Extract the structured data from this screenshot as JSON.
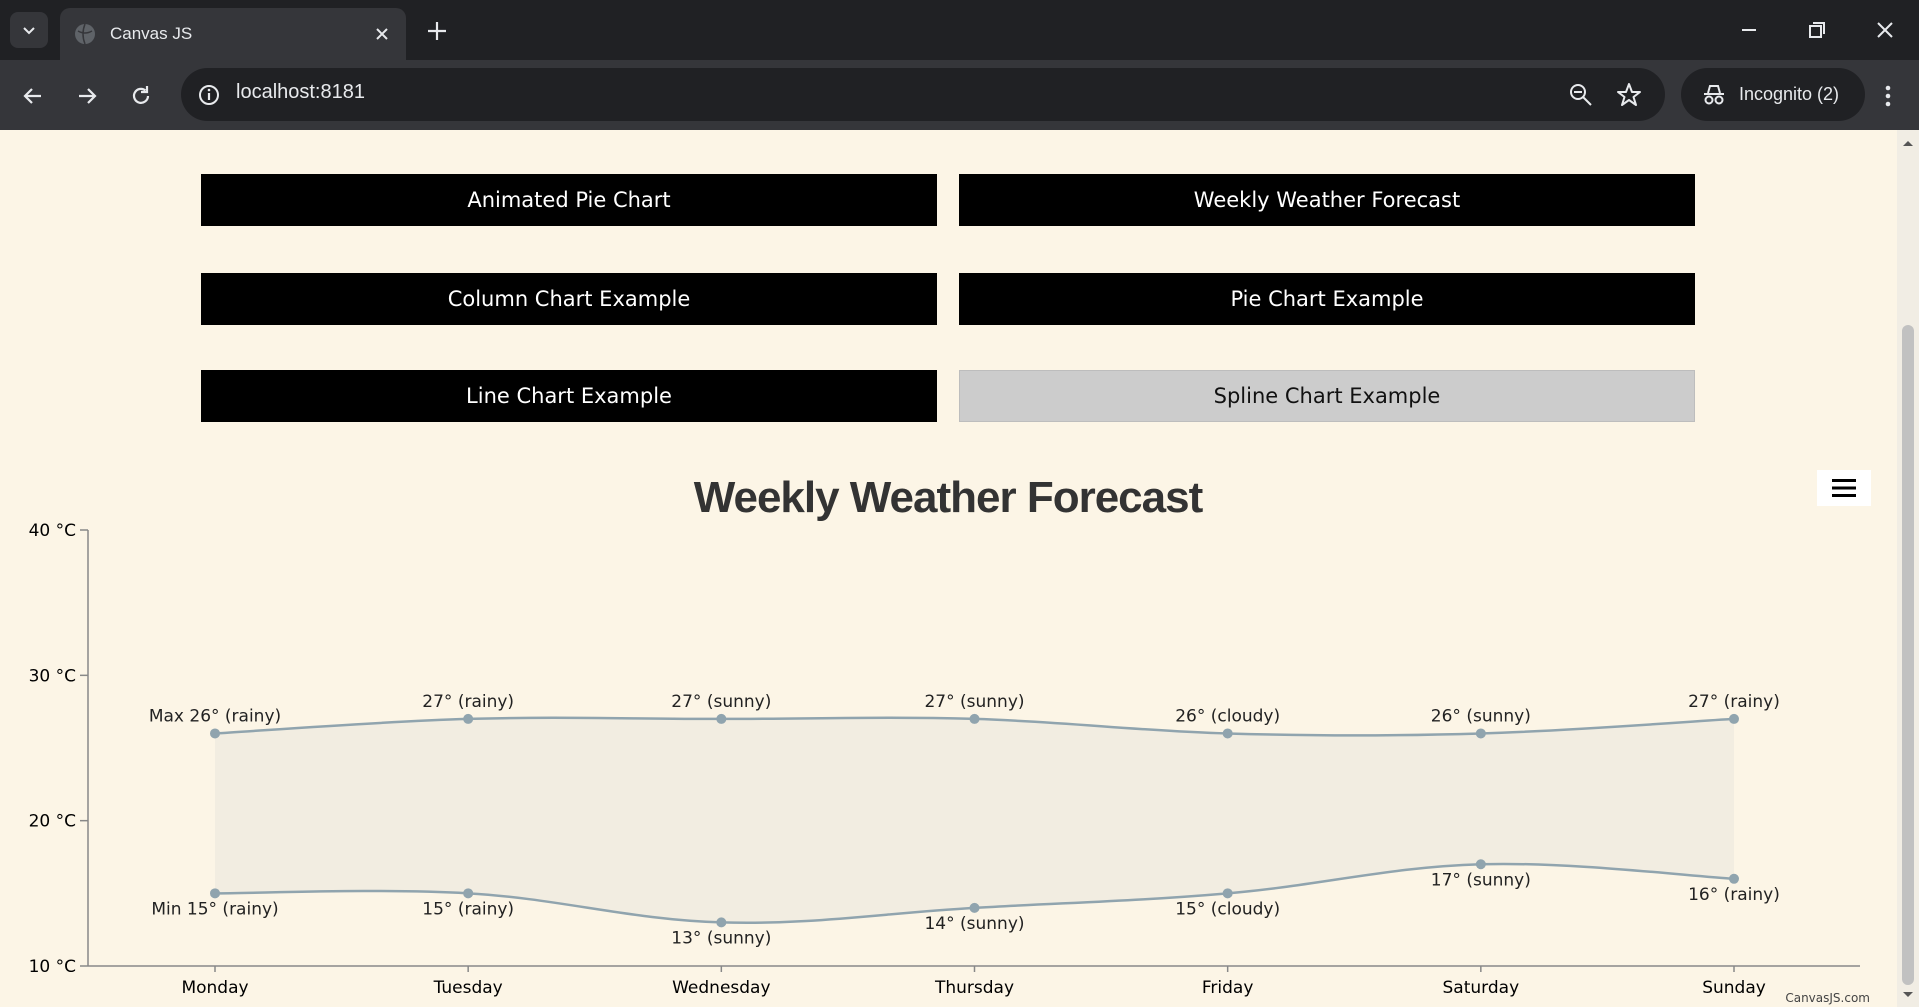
{
  "browser": {
    "tab_title": "Canvas JS",
    "url": "localhost:8181",
    "incognito_label": "Incognito (2)"
  },
  "buttons": [
    {
      "label": "Animated Pie Chart",
      "active": false
    },
    {
      "label": "Weekly Weather Forecast",
      "active": false
    },
    {
      "label": "Column Chart Example",
      "active": false
    },
    {
      "label": "Pie Chart Example",
      "active": false
    },
    {
      "label": "Line Chart Example",
      "active": false
    },
    {
      "label": "Spline Chart Example",
      "active": true
    }
  ],
  "chart_data": {
    "type": "area",
    "title": "Weekly Weather Forecast",
    "categories": [
      "Monday",
      "Tuesday",
      "Wednesday",
      "Thursday",
      "Friday",
      "Saturday",
      "Sunday"
    ],
    "y_ticks": [
      "40 °C",
      "30 °C",
      "20 °C",
      "10 °C"
    ],
    "ylim": [
      10,
      40
    ],
    "series": [
      {
        "values": [
          26,
          27,
          27,
          27,
          26,
          26,
          27
        ],
        "labels": [
          "Max 26° (rainy)",
          "27° (rainy)",
          "27° (sunny)",
          "27° (sunny)",
          "26° (cloudy)",
          "26° (sunny)",
          "27° (rainy)"
        ]
      },
      {
        "values": [
          15,
          15,
          13,
          14,
          15,
          17,
          16
        ],
        "labels": [
          "Min 15° (rainy)",
          "15° (rainy)",
          "13° (sunny)",
          "14° (sunny)",
          "15° (cloudy)",
          "17° (sunny)",
          "16° (rainy)"
        ]
      }
    ],
    "credit": "CanvasJS.com",
    "colors": {
      "line": "#90a4ae",
      "fill": "#f2ede1",
      "title": "#333333"
    }
  }
}
